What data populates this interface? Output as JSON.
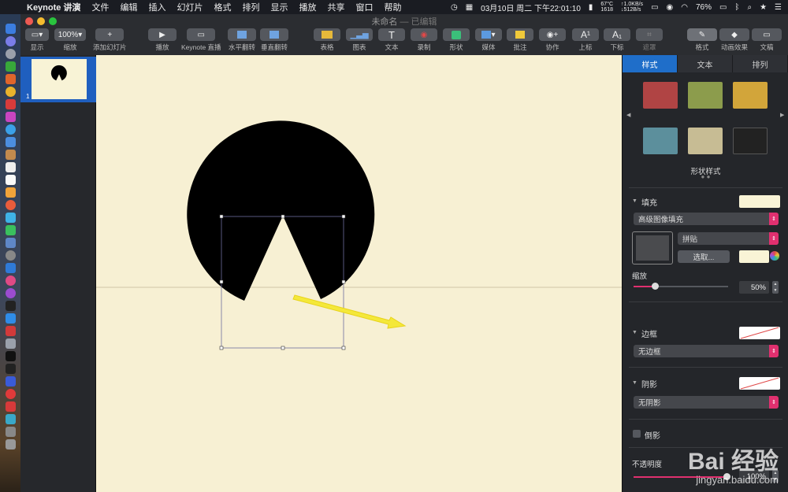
{
  "menubar": {
    "app_name": "Keynote 讲演",
    "menus": [
      "文件",
      "编辑",
      "插入",
      "幻灯片",
      "格式",
      "排列",
      "显示",
      "播放",
      "共享",
      "窗口",
      "帮助"
    ],
    "datetime": "03月10日 周二 下午22:01:10",
    "temp_top": "67°C",
    "temp_bottom": "1618",
    "net_up": "↑1.0KB/s",
    "net_down": "↓512B/s",
    "battery": "76%"
  },
  "window": {
    "title": "未命名",
    "title_suffix": "— 已编辑"
  },
  "toolbar": {
    "view_label": "显示",
    "zoom_value": "100%",
    "zoom_label": "缩放",
    "add_slide_label": "添加幻灯片",
    "play_label": "播放",
    "keynote_live_label": "Keynote 直播",
    "flip_h_label": "水平翻转",
    "flip_v_label": "垂直翻转",
    "table_label": "表格",
    "chart_label": "图表",
    "text_label": "文本",
    "record_label": "录制",
    "shape_label": "形状",
    "media_label": "媒体",
    "comment_label": "批注",
    "collaborate_label": "协作",
    "superscript_label": "上标",
    "subscript_label": "下标",
    "mask_label": "遮罩",
    "format_label": "格式",
    "animate_label": "动画效果",
    "document_label": "文稿"
  },
  "navigator": {
    "slide_number": "1"
  },
  "inspector": {
    "tabs": [
      "样式",
      "文本",
      "排列"
    ],
    "swatch_colors": [
      "#b04444",
      "#8c9c4c",
      "#d2a53a",
      "#5c8f9c",
      "#c7bc94",
      "#222222"
    ],
    "shape_styles_label": "形状样式",
    "fill_label": "填充",
    "fill_type": "高级图像填充",
    "tile_mode": "拼贴",
    "choose_button": "选取...",
    "scale_label": "缩放",
    "scale_value": "50%",
    "border_label": "边框",
    "border_value": "无边框",
    "shadow_label": "阴影",
    "shadow_value": "无阴影",
    "reflection_label": "倒影",
    "opacity_label": "不透明度",
    "opacity_value": "100%",
    "fill_color": "#f9f4d6",
    "accent_color": "#e0306f"
  },
  "watermark": {
    "brand": "Bai 经验",
    "url": "jingyan.baidu.com"
  }
}
